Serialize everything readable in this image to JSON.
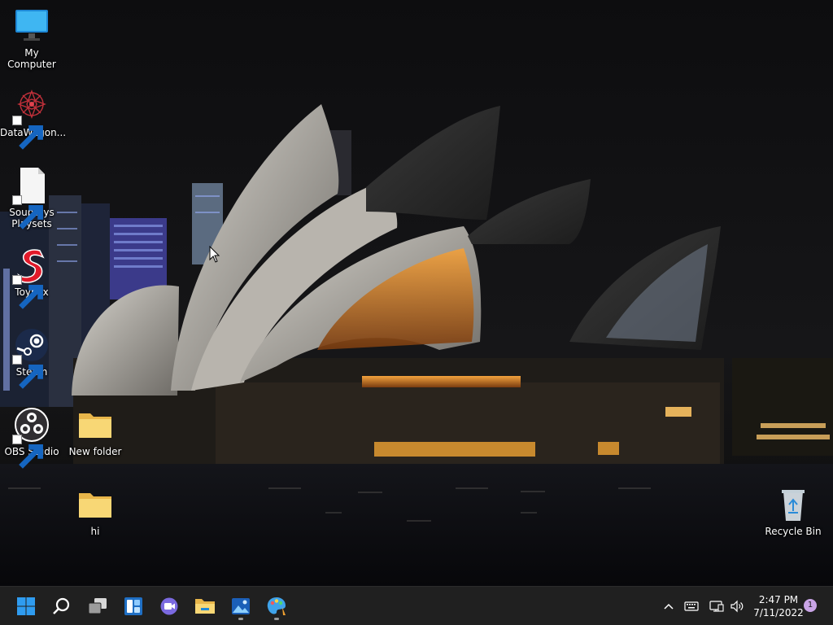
{
  "desktop": {
    "icons": [
      {
        "label": "My Computer",
        "icon": "monitor-icon",
        "shortcut": false
      },
      {
        "label": "DataWagon...",
        "icon": "datawagon-icon",
        "shortcut": true
      },
      {
        "label": "Souptoys\nPlaysets",
        "icon": "document-icon",
        "shortcut": true
      },
      {
        "label": "Toybox",
        "icon": "toybox-icon",
        "shortcut": true
      },
      {
        "label": "Steam",
        "icon": "steam-icon",
        "shortcut": true
      },
      {
        "label": "OBS Studio",
        "icon": "obs-icon",
        "shortcut": true
      },
      {
        "label": "New folder",
        "icon": "folder-icon",
        "shortcut": false
      },
      {
        "label": "hi",
        "icon": "folder-icon",
        "shortcut": false
      },
      {
        "label": "Recycle Bin",
        "icon": "recycle-bin-icon",
        "shortcut": false
      }
    ]
  },
  "taskbar": {
    "apps": [
      {
        "name": "Start",
        "icon": "windows-start-icon",
        "running": false
      },
      {
        "name": "Search",
        "icon": "search-icon",
        "running": false
      },
      {
        "name": "Task View",
        "icon": "task-view-icon",
        "running": false
      },
      {
        "name": "Widgets",
        "icon": "widgets-icon",
        "running": false
      },
      {
        "name": "Chat",
        "icon": "teams-chat-icon",
        "running": false
      },
      {
        "name": "File Explorer",
        "icon": "file-explorer-icon",
        "running": false
      },
      {
        "name": "Photos",
        "icon": "photos-icon",
        "running": true
      },
      {
        "name": "Paint",
        "icon": "paint-icon",
        "running": true
      }
    ],
    "tray": {
      "icons": [
        "chevron-up-icon",
        "keyboard-icon",
        "network-icon",
        "volume-icon"
      ],
      "time": "2:47 PM",
      "date": "7/11/2022",
      "notification_count": "1"
    }
  },
  "colors": {
    "taskbar_bg": "#202020",
    "accent": "#0078d4",
    "folder": "#f8d775",
    "badge": "#c9a4e6"
  }
}
